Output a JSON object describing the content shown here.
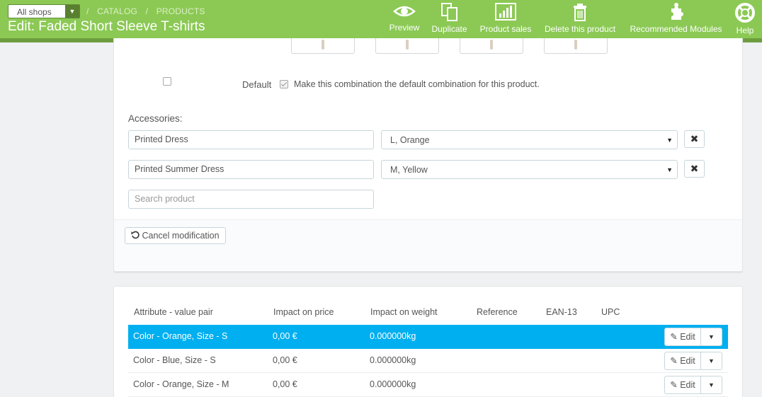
{
  "header": {
    "shop_select": "All shops",
    "breadcrumb": [
      "CATALOG",
      "PRODUCTS"
    ],
    "title": "Edit: Faded Short Sleeve T-shirts",
    "toolbar": [
      {
        "label": "Preview",
        "icon": "eye-icon"
      },
      {
        "label": "Duplicate",
        "icon": "copy-icon"
      },
      {
        "label": "Product sales",
        "icon": "bar-chart-icon"
      },
      {
        "label": "Delete this product",
        "icon": "trash-icon"
      },
      {
        "label": "Recommended Modules",
        "icon": "puzzle-icon"
      },
      {
        "label": "Help",
        "icon": "lifebuoy-icon"
      }
    ]
  },
  "combination_form": {
    "default_label": "Default",
    "default_checkbox_text": "Make this combination the default combination for this product.",
    "accessories_label": "Accessories:",
    "accessories": [
      {
        "product": "Printed Dress",
        "combination": "L, Orange"
      },
      {
        "product": "Printed Summer Dress",
        "combination": "M, Yellow"
      }
    ],
    "search_placeholder": "Search product",
    "cancel_label": "Cancel modification"
  },
  "combinations_table": {
    "headers": [
      "Attribute - value pair",
      "Impact on price",
      "Impact on weight",
      "Reference",
      "EAN-13",
      "UPC"
    ],
    "rows": [
      {
        "attribute": "Color - Orange, Size - S",
        "price": "0,00 €",
        "weight": "0.000000kg",
        "selected": true
      },
      {
        "attribute": "Color - Blue, Size - S",
        "price": "0,00 €",
        "weight": "0.000000kg",
        "selected": false
      },
      {
        "attribute": "Color - Orange, Size - M",
        "price": "0,00 €",
        "weight": "0.000000kg",
        "selected": false
      }
    ],
    "edit_label": "Edit"
  },
  "colors": {
    "header_green": "#8bc954",
    "selected_row": "#00aff0"
  }
}
